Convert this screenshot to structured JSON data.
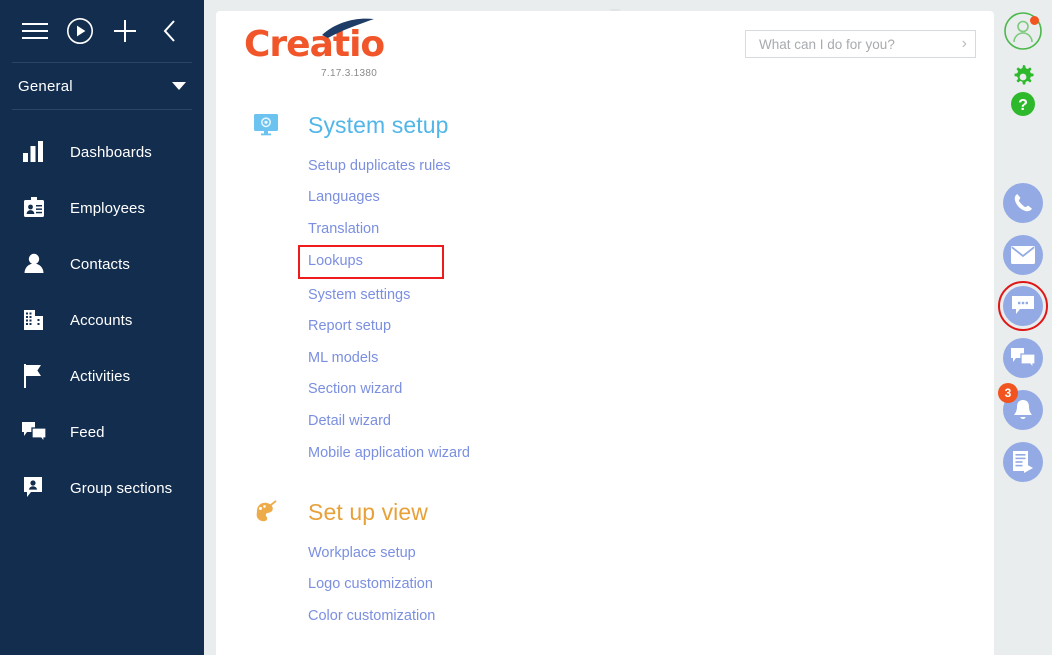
{
  "sidebar": {
    "tools": [
      {
        "name": "menu-icon",
        "label": "Menu"
      },
      {
        "name": "run-process-icon",
        "label": "Run process"
      },
      {
        "name": "add-icon",
        "label": "Add"
      },
      {
        "name": "collapse-icon",
        "label": "Collapse"
      }
    ],
    "workplace": {
      "label": "General"
    },
    "items": [
      {
        "label": "Dashboards",
        "icon": "dashboards-icon"
      },
      {
        "label": "Employees",
        "icon": "employees-icon"
      },
      {
        "label": "Contacts",
        "icon": "contacts-icon"
      },
      {
        "label": "Accounts",
        "icon": "accounts-icon"
      },
      {
        "label": "Activities",
        "icon": "activities-icon"
      },
      {
        "label": "Feed",
        "icon": "feed-icon"
      },
      {
        "label": "Group sections",
        "icon": "group-sections-icon"
      }
    ]
  },
  "header": {
    "logo_text": "Creatio",
    "version": "7.17.3.1380",
    "search": {
      "placeholder": "What can I do for you?",
      "value": ""
    }
  },
  "main": {
    "groups": [
      {
        "title": "System setup",
        "icon": "system-setup-icon",
        "color": "#51b6e8",
        "links": [
          {
            "label": "Setup duplicates rules",
            "highlighted": false
          },
          {
            "label": "Languages",
            "highlighted": false
          },
          {
            "label": "Translation",
            "highlighted": false
          },
          {
            "label": "Lookups",
            "highlighted": true
          },
          {
            "label": "System settings",
            "highlighted": false
          },
          {
            "label": "Report setup",
            "highlighted": false
          },
          {
            "label": "ML models",
            "highlighted": false
          },
          {
            "label": "Section wizard",
            "highlighted": false
          },
          {
            "label": "Detail wizard",
            "highlighted": false
          },
          {
            "label": "Mobile application wizard",
            "highlighted": false
          }
        ]
      },
      {
        "title": "Set up view",
        "icon": "set-up-view-icon",
        "color": "#e8a13a",
        "links": [
          {
            "label": "Workplace setup",
            "highlighted": false
          },
          {
            "label": "Logo customization",
            "highlighted": false
          },
          {
            "label": "Color customization",
            "highlighted": false
          }
        ]
      }
    ]
  },
  "right_rail": {
    "top": [
      {
        "name": "user-profile-icon",
        "has_dot": true
      },
      {
        "name": "gear-icon",
        "has_dot": false
      },
      {
        "name": "help-icon",
        "has_dot": false
      }
    ],
    "actions": [
      {
        "name": "phone-icon",
        "badge": "",
        "highlighted": false
      },
      {
        "name": "email-icon",
        "badge": "",
        "highlighted": false
      },
      {
        "name": "chat-icon",
        "badge": "",
        "highlighted": true
      },
      {
        "name": "feed-icon",
        "badge": "",
        "highlighted": false
      },
      {
        "name": "notifications-icon",
        "badge": "3",
        "highlighted": false
      },
      {
        "name": "process-log-icon",
        "badge": "",
        "highlighted": false
      }
    ]
  },
  "colors": {
    "sidebar_bg": "#132d4e",
    "link_blue": "#7b8fe0",
    "accent_orange": "#f1562a",
    "highlight_red": "#ee1c1c",
    "rail_blue": "#93aae4",
    "green": "#3db92c"
  }
}
